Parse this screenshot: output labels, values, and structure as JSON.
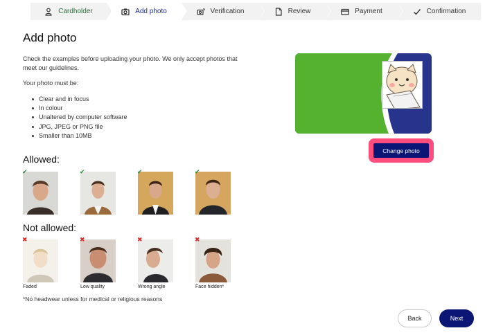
{
  "stepper": {
    "steps": [
      {
        "label": "Cardholder",
        "icon": "person-icon",
        "state": "done"
      },
      {
        "label": "Add photo",
        "icon": "camera-icon",
        "state": "active"
      },
      {
        "label": "Verification",
        "icon": "id-camera-icon",
        "state": "todo"
      },
      {
        "label": "Review",
        "icon": "document-icon",
        "state": "todo"
      },
      {
        "label": "Payment",
        "icon": "credit-card-icon",
        "state": "todo"
      },
      {
        "label": "Confirmation",
        "icon": "checkmark-icon",
        "state": "todo"
      }
    ]
  },
  "main": {
    "title": "Add photo",
    "intro": "Check the examples before uploading your photo. We only accept photos that meet our guidelines.",
    "must_heading": "Your photo must be:",
    "requirements": [
      "Clear and in focus",
      "In colour",
      "Unaltered by computer software",
      "JPG, JPEG or PNG file",
      "Smaller than 10MB"
    ],
    "allowed_heading": "Allowed:",
    "not_allowed_heading": "Not allowed:",
    "not_allowed_captions": [
      "Faded",
      "Low quality",
      "Wrong angle",
      "Face hidden*"
    ],
    "footnote": "*No headwear unless for medical or religious reasons"
  },
  "card": {
    "change_photo_label": "Change photo",
    "colors": {
      "green": "#55b22f",
      "blue": "#27348b",
      "highlight": "#ff4d7d"
    }
  },
  "nav": {
    "back_label": "Back",
    "next_label": "Next"
  },
  "colors": {
    "primary": "#0b1574",
    "done_step": "#2a6b3a",
    "ok": "#1f8a3a",
    "error": "#d0312d"
  }
}
